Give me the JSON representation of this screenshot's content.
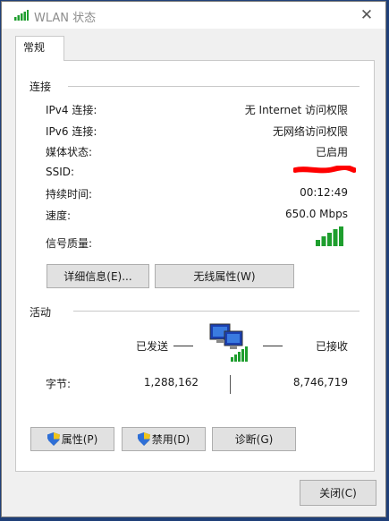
{
  "window": {
    "title": "WLAN 状态",
    "close_glyph": "✕"
  },
  "tab": {
    "label": "常规"
  },
  "connection": {
    "heading": "连接",
    "rows": [
      {
        "label": "IPv4 连接:",
        "value": "无 Internet 访问权限"
      },
      {
        "label": "IPv6 连接:",
        "value": "无网络访问权限"
      },
      {
        "label": "媒体状态:",
        "value": "已启用"
      },
      {
        "label": "SSID:",
        "value": ""
      },
      {
        "label": "持续时间:",
        "value": "00:12:49"
      },
      {
        "label": "速度:",
        "value": "650.0 Mbps"
      },
      {
        "label": "信号质量:",
        "value": ""
      }
    ],
    "signal_level": 5,
    "signal_max": 5,
    "details_button": "详细信息(E)...",
    "wireless_props_button": "无线属性(W)"
  },
  "activity": {
    "heading": "活动",
    "sent_label": "已发送",
    "received_label": "已接收",
    "bytes_label": "字节:",
    "bytes_sent": "1,288,162",
    "bytes_received": "8,746,719"
  },
  "buttons": {
    "properties": "属性(P)",
    "disable": "禁用(D)",
    "diagnose": "诊断(G)",
    "close": "关闭(C)"
  },
  "icons": {
    "title": "wifi-signal-icon",
    "network": "network-computers-icon",
    "shield": "uac-shield-icon"
  },
  "colors": {
    "signal_green": "#1e9e2e",
    "redaction_red": "#ff0000",
    "background": "#1f3f78"
  }
}
